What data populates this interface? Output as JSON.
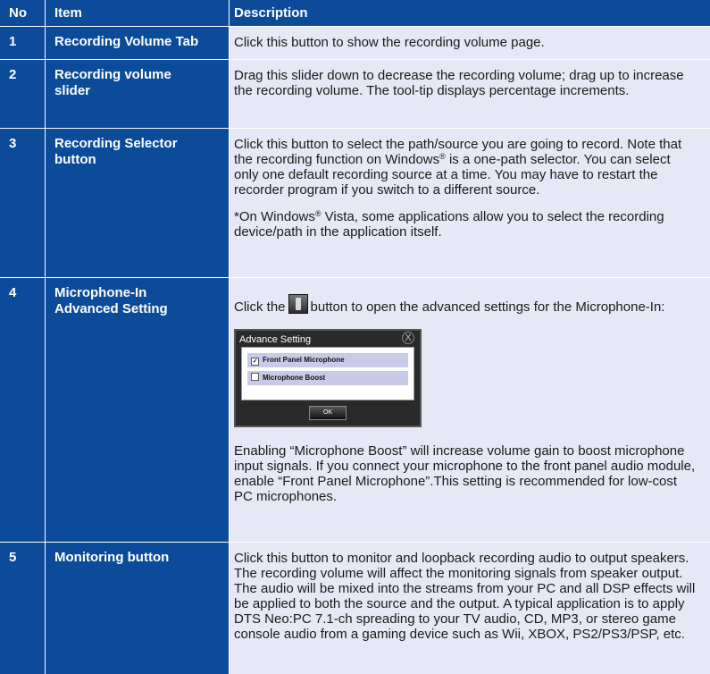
{
  "header": {
    "no": "No",
    "item": "Item",
    "description": "Description"
  },
  "rows": [
    {
      "no": "1",
      "item": "Recording Volume Tab",
      "desc": [
        "Click this button to show the recording volume page."
      ]
    },
    {
      "no": "2",
      "item": "Recording volume slider",
      "desc": [
        "Drag this slider down to decrease the recording volume; drag up to increase the recording volume. The tool-tip displays percentage increments."
      ]
    },
    {
      "no": "3",
      "item": "Recording Selector button",
      "desc_a": "Click this button to select the path/source you are going to record. Note that the recording function on Windows",
      "desc_sup": "®",
      "desc_b": " is a one-path selector. You can select only one default recording source at a time. You may have to restart the recorder program if you switch to a different source.",
      "note_a": "*On Windows",
      "note_sup": "®",
      "note_b": " Vista, some applications allow you to select the recording device/path in the application itself."
    },
    {
      "no": "4",
      "item": "Microphone-In Advanced Setting",
      "click_before": "Click the",
      "click_after": "button to open the advanced settings for the Microphone-In:",
      "dialog": {
        "title": "Advance Setting",
        "close": "X",
        "opt1": "Front Panel Microphone",
        "opt1_check": "✓",
        "opt2": "Microphone Boost",
        "ok": "OK"
      },
      "after": "Enabling “Microphone Boost” will increase volume gain to boost microphone input signals. If you connect your microphone to the front panel audio module, enable “Front Panel Microphone”.This setting is recommended for low-cost PC microphones."
    },
    {
      "no": "5",
      "item": "Monitoring button",
      "desc": [
        "Click this button to monitor and loopback recording audio to output speakers. The recording volume will affect the monitoring signals from speaker output. The audio will be mixed into the streams from your PC and all DSP effects will be applied to both the source and the output. A typical application is to apply DTS Neo:PC 7.1-ch spreading to your TV audio, CD, MP3, or stereo game console audio from a gaming device such as Wii, XBOX, PS2/PS3/PSP, etc."
      ]
    }
  ]
}
